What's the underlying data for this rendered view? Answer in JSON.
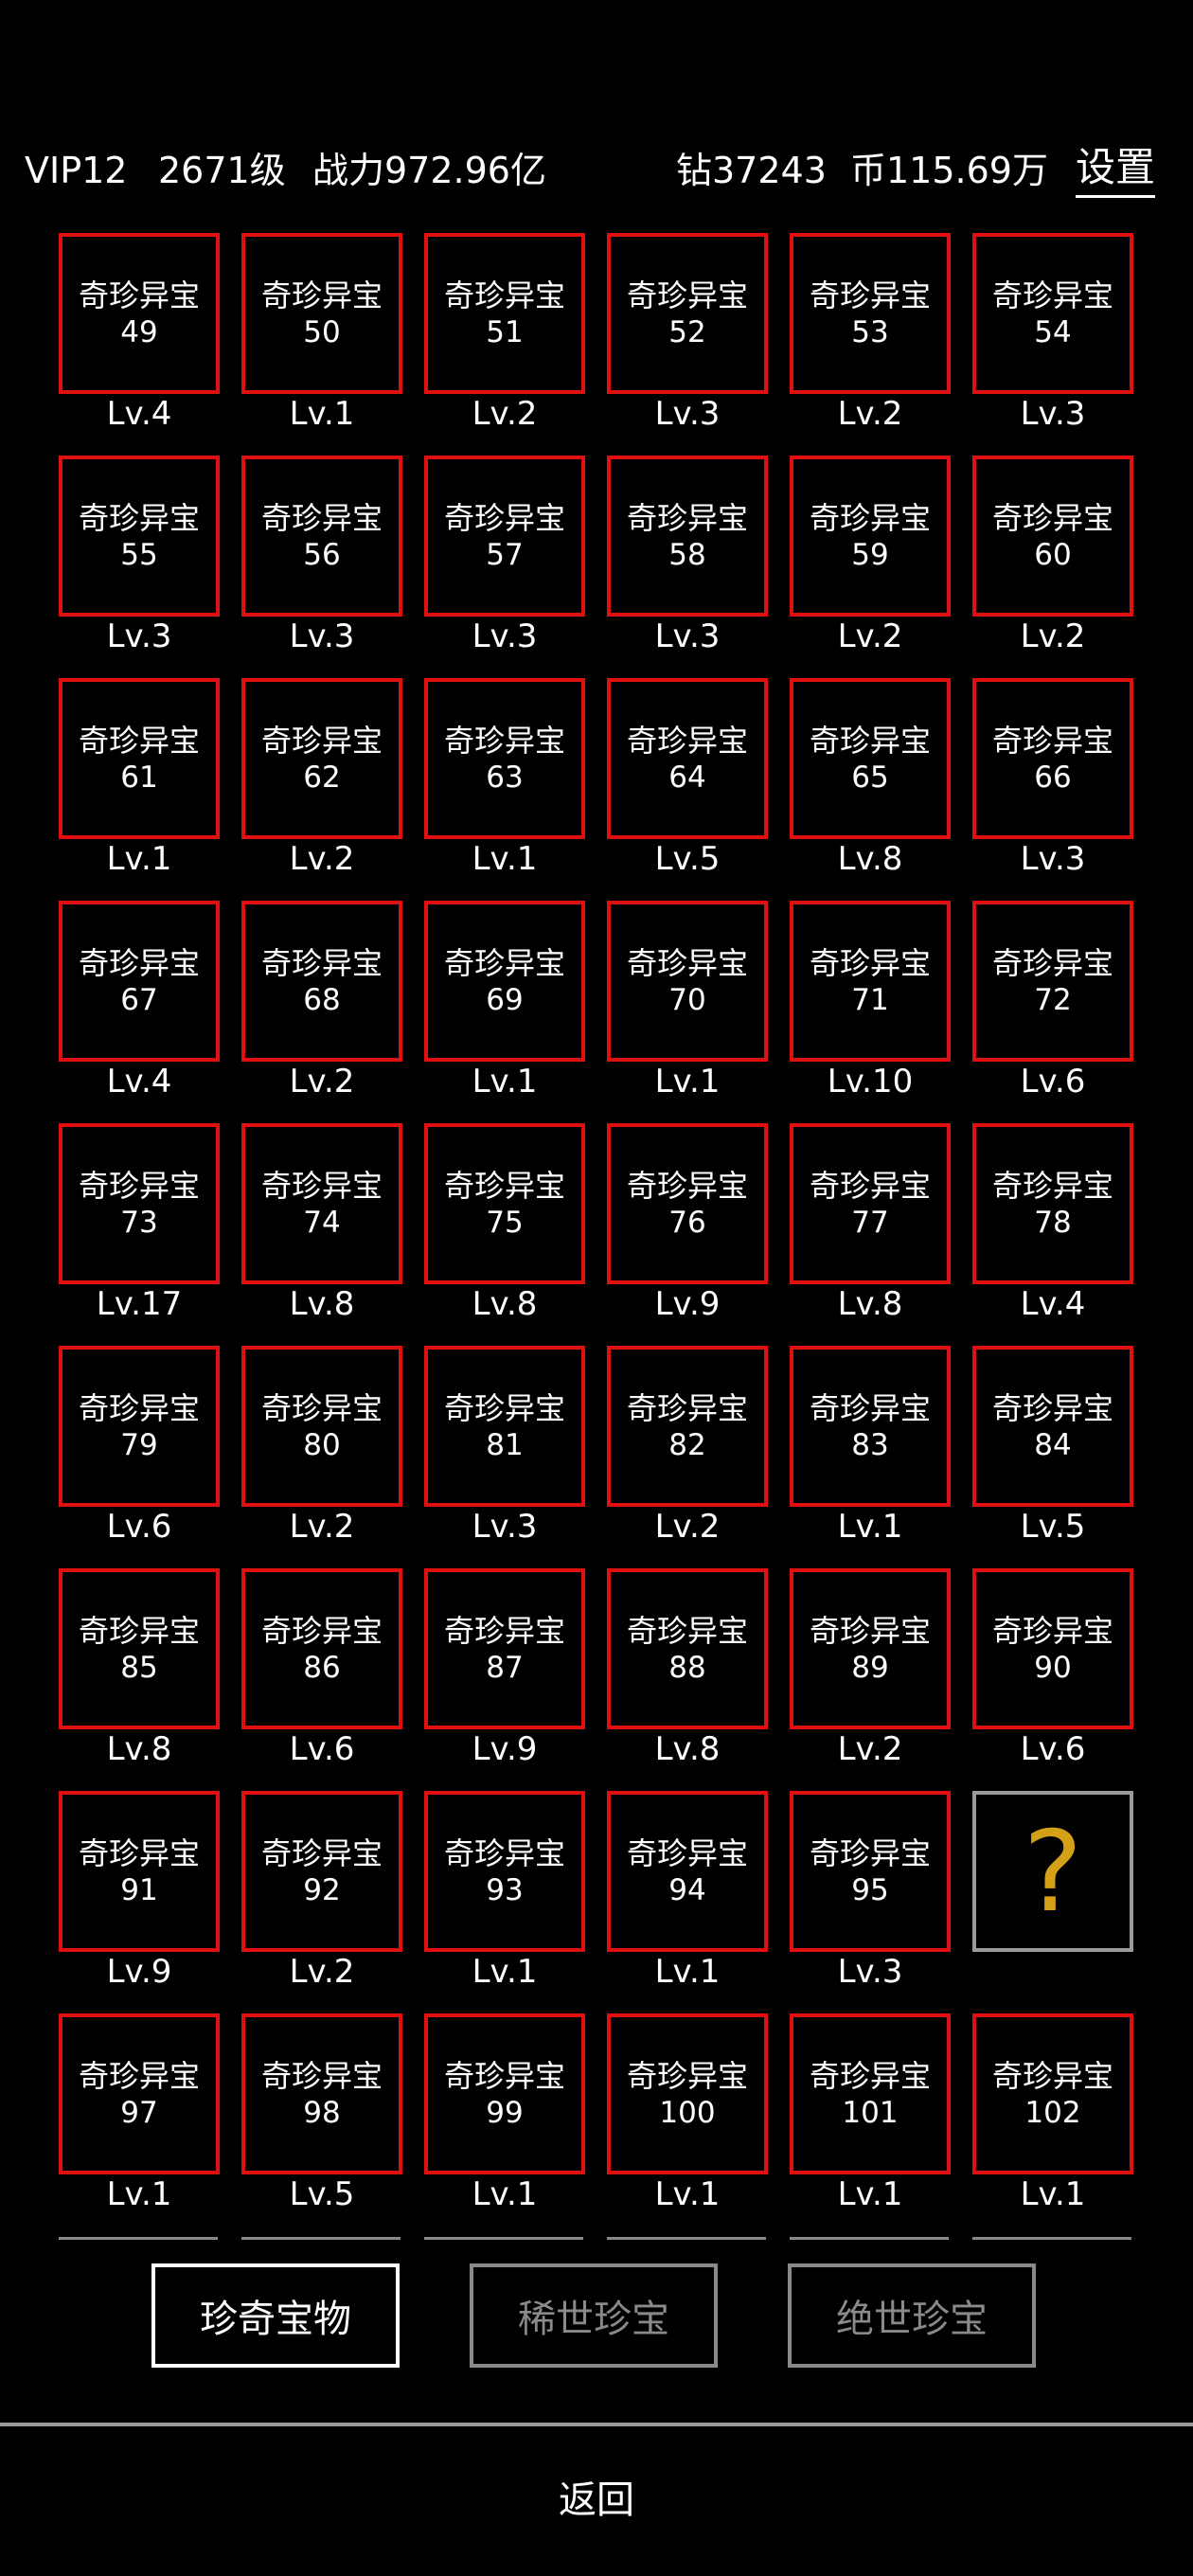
{
  "hud": {
    "vip": "VIP12",
    "level": "2671级",
    "power": "战力972.96亿",
    "diamond": "钻37243",
    "coin": "币115.69万",
    "settings": "设置"
  },
  "colors": {
    "card_border": "#e01010",
    "locked_border": "#9a9a9a",
    "question_mark": "#d4a017",
    "inactive_tab": "#8a8a8a"
  },
  "items": [
    {
      "name": "奇珍异宝",
      "num": "49",
      "lv": "Lv.4"
    },
    {
      "name": "奇珍异宝",
      "num": "50",
      "lv": "Lv.1"
    },
    {
      "name": "奇珍异宝",
      "num": "51",
      "lv": "Lv.2"
    },
    {
      "name": "奇珍异宝",
      "num": "52",
      "lv": "Lv.3"
    },
    {
      "name": "奇珍异宝",
      "num": "53",
      "lv": "Lv.2"
    },
    {
      "name": "奇珍异宝",
      "num": "54",
      "lv": "Lv.3"
    },
    {
      "name": "奇珍异宝",
      "num": "55",
      "lv": "Lv.3"
    },
    {
      "name": "奇珍异宝",
      "num": "56",
      "lv": "Lv.3"
    },
    {
      "name": "奇珍异宝",
      "num": "57",
      "lv": "Lv.3"
    },
    {
      "name": "奇珍异宝",
      "num": "58",
      "lv": "Lv.3"
    },
    {
      "name": "奇珍异宝",
      "num": "59",
      "lv": "Lv.2"
    },
    {
      "name": "奇珍异宝",
      "num": "60",
      "lv": "Lv.2"
    },
    {
      "name": "奇珍异宝",
      "num": "61",
      "lv": "Lv.1"
    },
    {
      "name": "奇珍异宝",
      "num": "62",
      "lv": "Lv.2"
    },
    {
      "name": "奇珍异宝",
      "num": "63",
      "lv": "Lv.1"
    },
    {
      "name": "奇珍异宝",
      "num": "64",
      "lv": "Lv.5"
    },
    {
      "name": "奇珍异宝",
      "num": "65",
      "lv": "Lv.8"
    },
    {
      "name": "奇珍异宝",
      "num": "66",
      "lv": "Lv.3"
    },
    {
      "name": "奇珍异宝",
      "num": "67",
      "lv": "Lv.4"
    },
    {
      "name": "奇珍异宝",
      "num": "68",
      "lv": "Lv.2"
    },
    {
      "name": "奇珍异宝",
      "num": "69",
      "lv": "Lv.1"
    },
    {
      "name": "奇珍异宝",
      "num": "70",
      "lv": "Lv.1"
    },
    {
      "name": "奇珍异宝",
      "num": "71",
      "lv": "Lv.10"
    },
    {
      "name": "奇珍异宝",
      "num": "72",
      "lv": "Lv.6"
    },
    {
      "name": "奇珍异宝",
      "num": "73",
      "lv": "Lv.17"
    },
    {
      "name": "奇珍异宝",
      "num": "74",
      "lv": "Lv.8"
    },
    {
      "name": "奇珍异宝",
      "num": "75",
      "lv": "Lv.8"
    },
    {
      "name": "奇珍异宝",
      "num": "76",
      "lv": "Lv.9"
    },
    {
      "name": "奇珍异宝",
      "num": "77",
      "lv": "Lv.8"
    },
    {
      "name": "奇珍异宝",
      "num": "78",
      "lv": "Lv.4"
    },
    {
      "name": "奇珍异宝",
      "num": "79",
      "lv": "Lv.6"
    },
    {
      "name": "奇珍异宝",
      "num": "80",
      "lv": "Lv.2"
    },
    {
      "name": "奇珍异宝",
      "num": "81",
      "lv": "Lv.3"
    },
    {
      "name": "奇珍异宝",
      "num": "82",
      "lv": "Lv.2"
    },
    {
      "name": "奇珍异宝",
      "num": "83",
      "lv": "Lv.1"
    },
    {
      "name": "奇珍异宝",
      "num": "84",
      "lv": "Lv.5"
    },
    {
      "name": "奇珍异宝",
      "num": "85",
      "lv": "Lv.8"
    },
    {
      "name": "奇珍异宝",
      "num": "86",
      "lv": "Lv.6"
    },
    {
      "name": "奇珍异宝",
      "num": "87",
      "lv": "Lv.9"
    },
    {
      "name": "奇珍异宝",
      "num": "88",
      "lv": "Lv.8"
    },
    {
      "name": "奇珍异宝",
      "num": "89",
      "lv": "Lv.2"
    },
    {
      "name": "奇珍异宝",
      "num": "90",
      "lv": "Lv.6"
    },
    {
      "name": "奇珍异宝",
      "num": "91",
      "lv": "Lv.9"
    },
    {
      "name": "奇珍异宝",
      "num": "92",
      "lv": "Lv.2"
    },
    {
      "name": "奇珍异宝",
      "num": "93",
      "lv": "Lv.1"
    },
    {
      "name": "奇珍异宝",
      "num": "94",
      "lv": "Lv.1"
    },
    {
      "name": "奇珍异宝",
      "num": "95",
      "lv": "Lv.3"
    },
    {
      "unknown": true,
      "symbol": "?"
    },
    {
      "name": "奇珍异宝",
      "num": "97",
      "lv": "Lv.1"
    },
    {
      "name": "奇珍异宝",
      "num": "98",
      "lv": "Lv.5"
    },
    {
      "name": "奇珍异宝",
      "num": "99",
      "lv": "Lv.1"
    },
    {
      "name": "奇珍异宝",
      "num": "100",
      "lv": "Lv.1"
    },
    {
      "name": "奇珍异宝",
      "num": "101",
      "lv": "Lv.1"
    },
    {
      "name": "奇珍异宝",
      "num": "102",
      "lv": "Lv.1"
    }
  ],
  "tabs": [
    {
      "label": "珍奇宝物",
      "active": true
    },
    {
      "label": "稀世珍宝",
      "active": false
    },
    {
      "label": "绝世珍宝",
      "active": false
    }
  ],
  "back_label": "返回"
}
